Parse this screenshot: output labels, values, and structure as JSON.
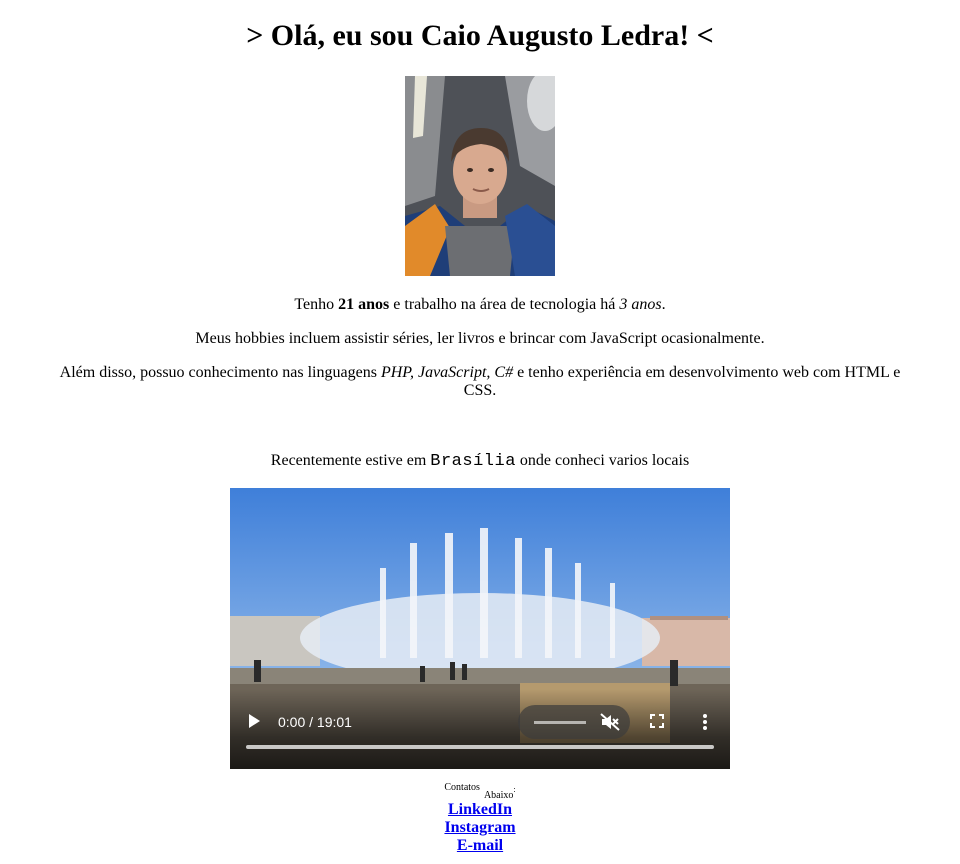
{
  "heading": "> Olá, eu sou Caio Augusto Ledra! <",
  "intro": {
    "p1_a": "Tenho ",
    "p1_age": "21 anos",
    "p1_b": " e trabalho na área de tecnologia há ",
    "p1_years": "3 anos",
    "p1_c": ".",
    "p2": "Meus hobbies incluem assistir séries, ler livros e brincar com JavaScript ocasionalmente.",
    "p3_a": "Além disso, possuo conhecimento nas linguagens ",
    "p3_langs": "PHP, JavaScript, C#",
    "p3_b": " e tenho experiência em desenvolvimento web com HTML e CSS."
  },
  "travel": {
    "text_a": "Recentemente estive em ",
    "city": "Brasília",
    "text_b": " onde conheci varios locais"
  },
  "video": {
    "time": "0:00 / 19:01",
    "progress": 0,
    "volume_muted": true,
    "icons": [
      "play-icon",
      "volume-muted-icon",
      "fullscreen-icon",
      "more-options-icon"
    ]
  },
  "contacts": {
    "label_a": "Contatos",
    "label_b": "Abaixo",
    "label_c": ":",
    "links": [
      "LinkedIn",
      "Instagram",
      "E-mail"
    ]
  }
}
